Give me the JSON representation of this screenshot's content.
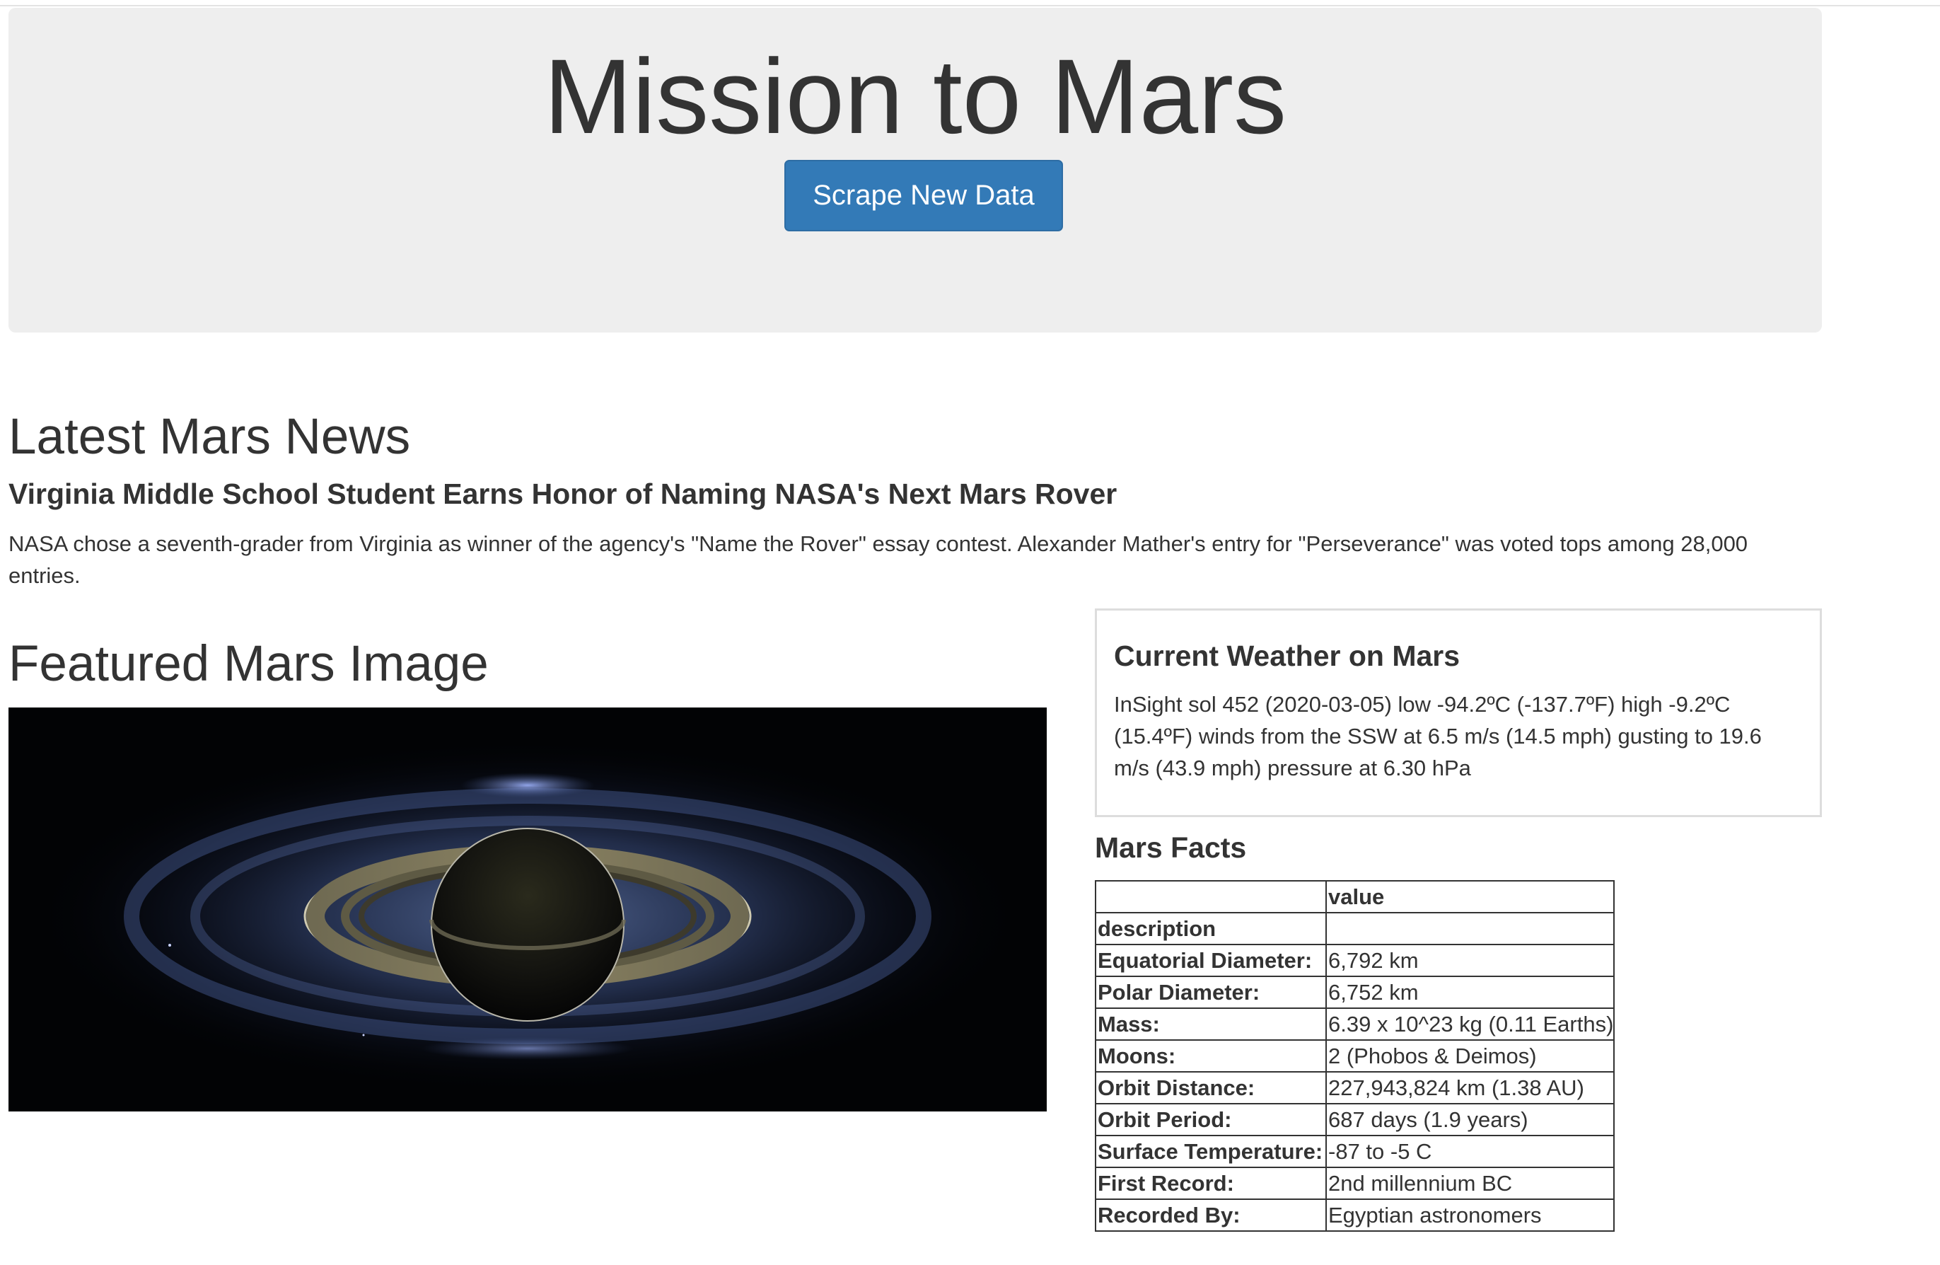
{
  "header": {
    "title": "Mission to Mars",
    "scrape_button_label": "Scrape New Data"
  },
  "news": {
    "section_title": "Latest Mars News",
    "headline": "Virginia Middle School Student Earns Honor of Naming NASA's Next Mars Rover",
    "paragraph": "NASA chose a seventh-grader from Virginia as winner of the agency's \"Name the Rover\" essay contest. Alexander Mather's entry for \"Perseverance\" was voted tops among 28,000 entries."
  },
  "featured": {
    "section_title": "Featured Mars Image"
  },
  "weather": {
    "title": "Current Weather on Mars",
    "text": "InSight sol 452 (2020-03-05) low -94.2ºC (-137.7ºF) high -9.2ºC (15.4ºF) winds from the SSW at 6.5 m/s (14.5 mph) gusting to 19.6 m/s (43.9 mph) pressure at 6.30 hPa"
  },
  "facts": {
    "title": "Mars Facts",
    "header_blank": "",
    "header_value": "value",
    "index_label": "description",
    "rows": [
      {
        "label": "Equatorial Diameter:",
        "value": "6,792 km"
      },
      {
        "label": "Polar Diameter:",
        "value": "6,752 km"
      },
      {
        "label": "Mass:",
        "value": "6.39 x 10^23 kg (0.11 Earths)"
      },
      {
        "label": "Moons:",
        "value": "2 (Phobos & Deimos)"
      },
      {
        "label": "Orbit Distance:",
        "value": "227,943,824 km (1.38 AU)"
      },
      {
        "label": "Orbit Period:",
        "value": "687 days (1.9 years)"
      },
      {
        "label": "Surface Temperature:",
        "value": "-87 to -5 C"
      },
      {
        "label": "First Record:",
        "value": "2nd millennium BC"
      },
      {
        "label": "Recorded By:",
        "value": "Egyptian astronomers"
      }
    ]
  },
  "colors": {
    "jumbotron_bg": "#eeeeee",
    "button_bg": "#337ab7",
    "text": "#333333"
  }
}
